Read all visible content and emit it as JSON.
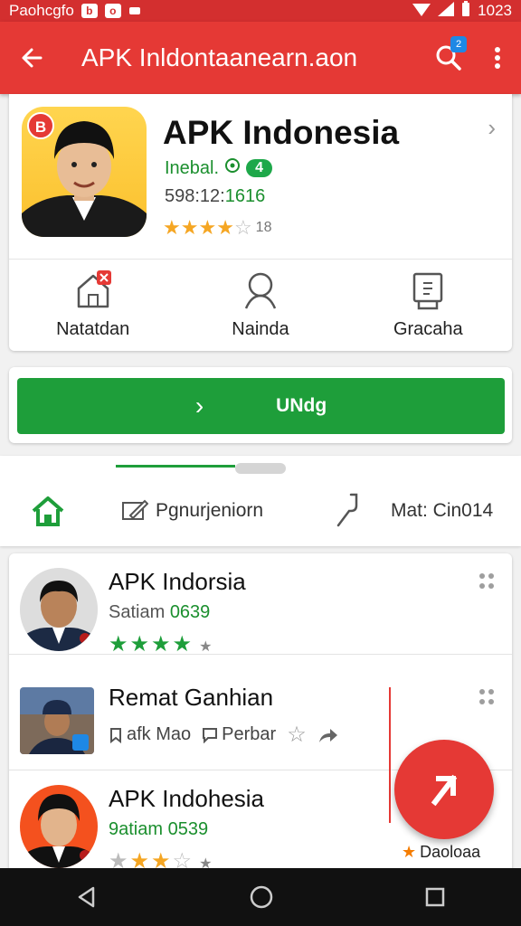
{
  "status_bar": {
    "left_text": "Paohcgfo",
    "icon_a": "b",
    "icon_b": "o",
    "time": "1023"
  },
  "app_bar": {
    "title": "APK Inldontaanearn.aon",
    "search_badge": "2"
  },
  "app": {
    "name": "APK Indonesia",
    "developer": "Inebal.",
    "developer_badge": "4",
    "downloads_prefix": "598:12:",
    "downloads_value": "1616",
    "rating_value": 3.5,
    "rating_count": "18",
    "corner_badge": "B",
    "actions": [
      {
        "label": "Natatdan",
        "icon": "home-badge-icon"
      },
      {
        "label": "Nainda",
        "icon": "person-icon"
      },
      {
        "label": "Gracaha",
        "icon": "book-icon"
      }
    ]
  },
  "install": {
    "label": "UNdg"
  },
  "tabs": [
    {
      "label": "",
      "icon": "home-icon"
    },
    {
      "label": "Pgnurjeniorn",
      "icon": "edit-icon"
    },
    {
      "label": "",
      "icon": "key-icon"
    },
    {
      "label": "Mat: Cin014",
      "icon": ""
    }
  ],
  "list": [
    {
      "name": "APK Indorsia",
      "sub_prefix": "Satiam ",
      "sub_value": "0639",
      "stars": 4,
      "tiny": "★"
    },
    {
      "name": "Remat Ganhian",
      "meta_a": "afk Mao",
      "meta_b": "Perbar"
    },
    {
      "name": "APK Indohesia",
      "sub_prefix": "9atiam ",
      "sub_value": "0539",
      "stars": 3,
      "tiny": "★"
    }
  ],
  "fab": {
    "label": "Daoloaa"
  },
  "colors": {
    "primary": "#e53935",
    "green": "#1e9e3a",
    "star": "#f5a623"
  }
}
